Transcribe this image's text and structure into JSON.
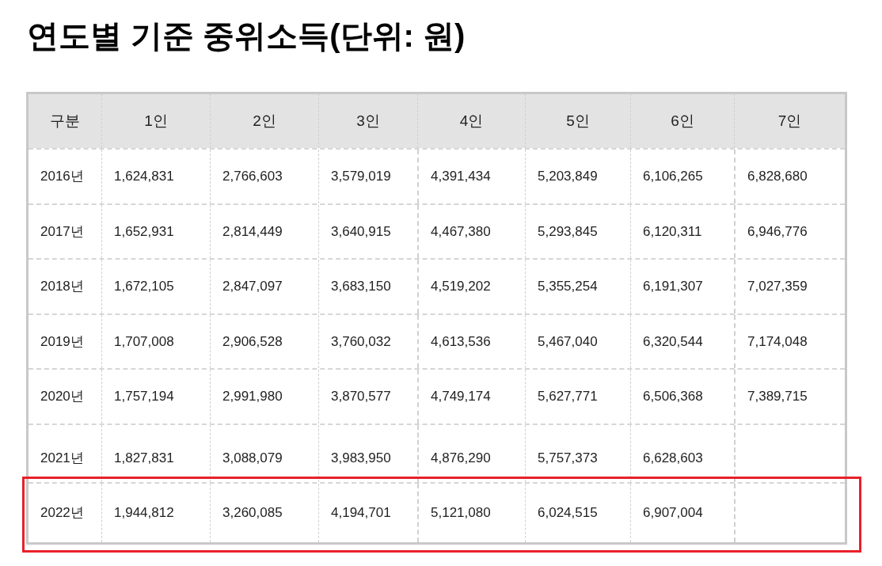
{
  "title": "연도별 기준 중위소득(단위: 원)",
  "table": {
    "columns": [
      "구분",
      "1인",
      "2인",
      "3인",
      "4인",
      "5인",
      "6인",
      "7인"
    ],
    "rows": [
      {
        "year": "2016년",
        "values": [
          "1,624,831",
          "2,766,603",
          "3,579,019",
          "4,391,434",
          "5,203,849",
          "6,106,265",
          "6,828,680"
        ],
        "highlighted": false
      },
      {
        "year": "2017년",
        "values": [
          "1,652,931",
          "2,814,449",
          "3,640,915",
          "4,467,380",
          "5,293,845",
          "6,120,311",
          "6,946,776"
        ],
        "highlighted": false
      },
      {
        "year": "2018년",
        "values": [
          "1,672,105",
          "2,847,097",
          "3,683,150",
          "4,519,202",
          "5,355,254",
          "6,191,307",
          "7,027,359"
        ],
        "highlighted": false
      },
      {
        "year": "2019년",
        "values": [
          "1,707,008",
          "2,906,528",
          "3,760,032",
          "4,613,536",
          "5,467,040",
          "6,320,544",
          "7,174,048"
        ],
        "highlighted": false
      },
      {
        "year": "2020년",
        "values": [
          "1,757,194",
          "2,991,980",
          "3,870,577",
          "4,749,174",
          "5,627,771",
          "6,506,368",
          "7,389,715"
        ],
        "highlighted": false
      },
      {
        "year": "2021년",
        "values": [
          "1,827,831",
          "3,088,079",
          "3,983,950",
          "4,876,290",
          "5,757,373",
          "6,628,603"
        ],
        "highlighted": false
      },
      {
        "year": "2022년",
        "values": [
          "1,944,812",
          "3,260,085",
          "4,194,701",
          "5,121,080",
          "6,024,515",
          "6,907,004"
        ],
        "highlighted": true
      }
    ]
  }
}
